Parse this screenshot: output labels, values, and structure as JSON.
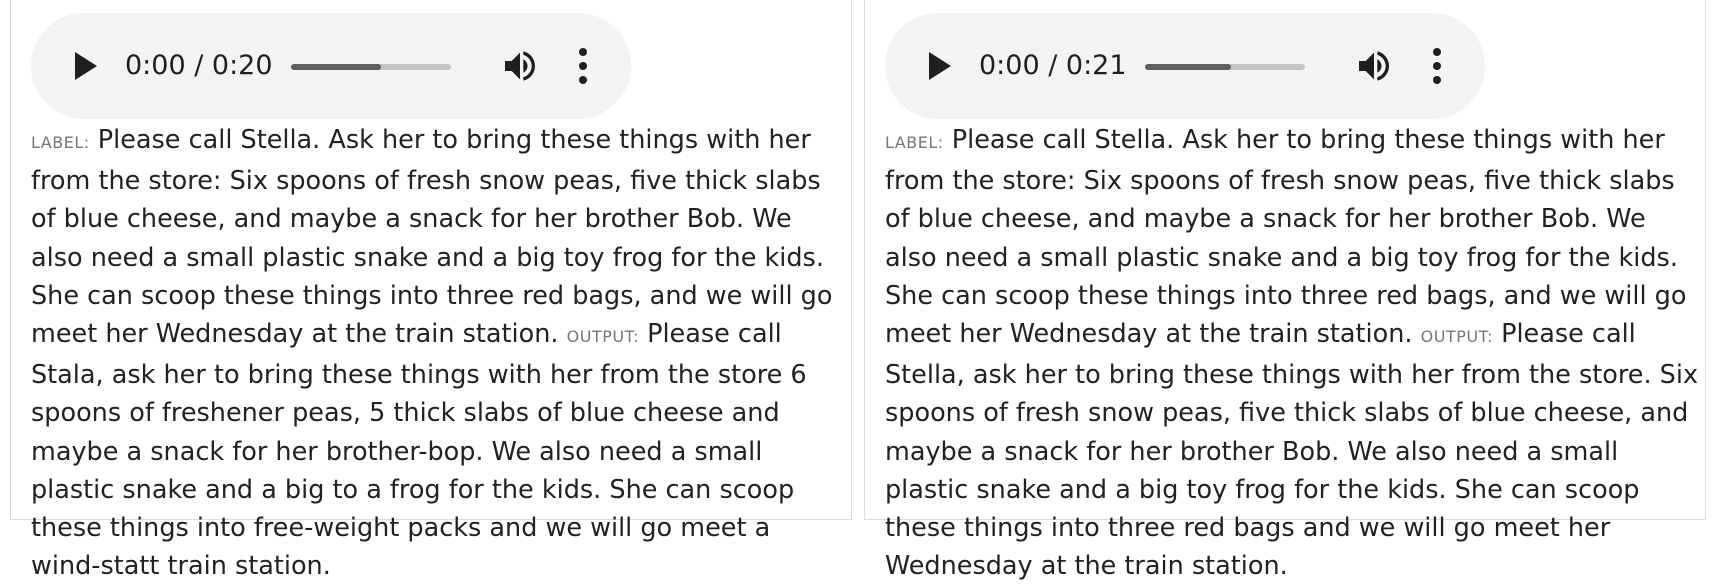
{
  "examples": [
    {
      "audio": {
        "current_time": "0:00",
        "duration": "0:20",
        "time_display": "0:00 / 0:20",
        "progress": 0.56,
        "icons": [
          "play-icon",
          "volume-icon",
          "more-options-icon"
        ]
      },
      "label_tag": "LABEL:",
      "label_text": "Please call Stella. Ask her to bring these things with her from the store: Six spoons of fresh snow peas, five thick slabs of blue cheese, and maybe a snack for her brother Bob. We also need a small plastic snake and a big toy frog for the kids. She can scoop these things into three red bags, and we will go meet her Wednesday at the train station.",
      "output_tag": "OUTPUT:",
      "output_text": "Please call Stala, ask her to bring these things with her from the store 6 spoons of freshener peas, 5 thick slabs of blue cheese and maybe a snack for her brother-bop. We also need a small plastic snake and a big to a frog for the kids. She can scoop these things into free-weight packs and we will go meet a wind-statt train station."
    },
    {
      "audio": {
        "current_time": "0:00",
        "duration": "0:21",
        "time_display": "0:00 / 0:21",
        "progress": 0.54,
        "icons": [
          "play-icon",
          "volume-icon",
          "more-options-icon"
        ]
      },
      "label_tag": "LABEL:",
      "label_text": "Please call Stella. Ask her to bring these things with her from the store: Six spoons of fresh snow peas, five thick slabs of blue cheese, and maybe a snack for her brother Bob. We also need a small plastic snake and a big toy frog for the kids. She can scoop these things into three red bags, and we will go meet her Wednesday at the train station.",
      "output_tag": "OUTPUT:",
      "output_text": "Please call Stella, ask her to bring these things with her from the store. Six spoons of fresh snow peas, five thick slabs of blue cheese, and maybe a snack for her brother Bob. We also need a small plastic snake and a big toy frog for the kids. She can scoop these things into three red bags and we will go meet her Wednesday at the train station."
    }
  ],
  "colors": {
    "player_background": "#f1f3f4",
    "seek_track": "#c4c4c4",
    "seek_fill": "#5f5f5f",
    "tag_text": "#767676",
    "body_text": "#222222",
    "card_border": "#dcdcdc"
  }
}
